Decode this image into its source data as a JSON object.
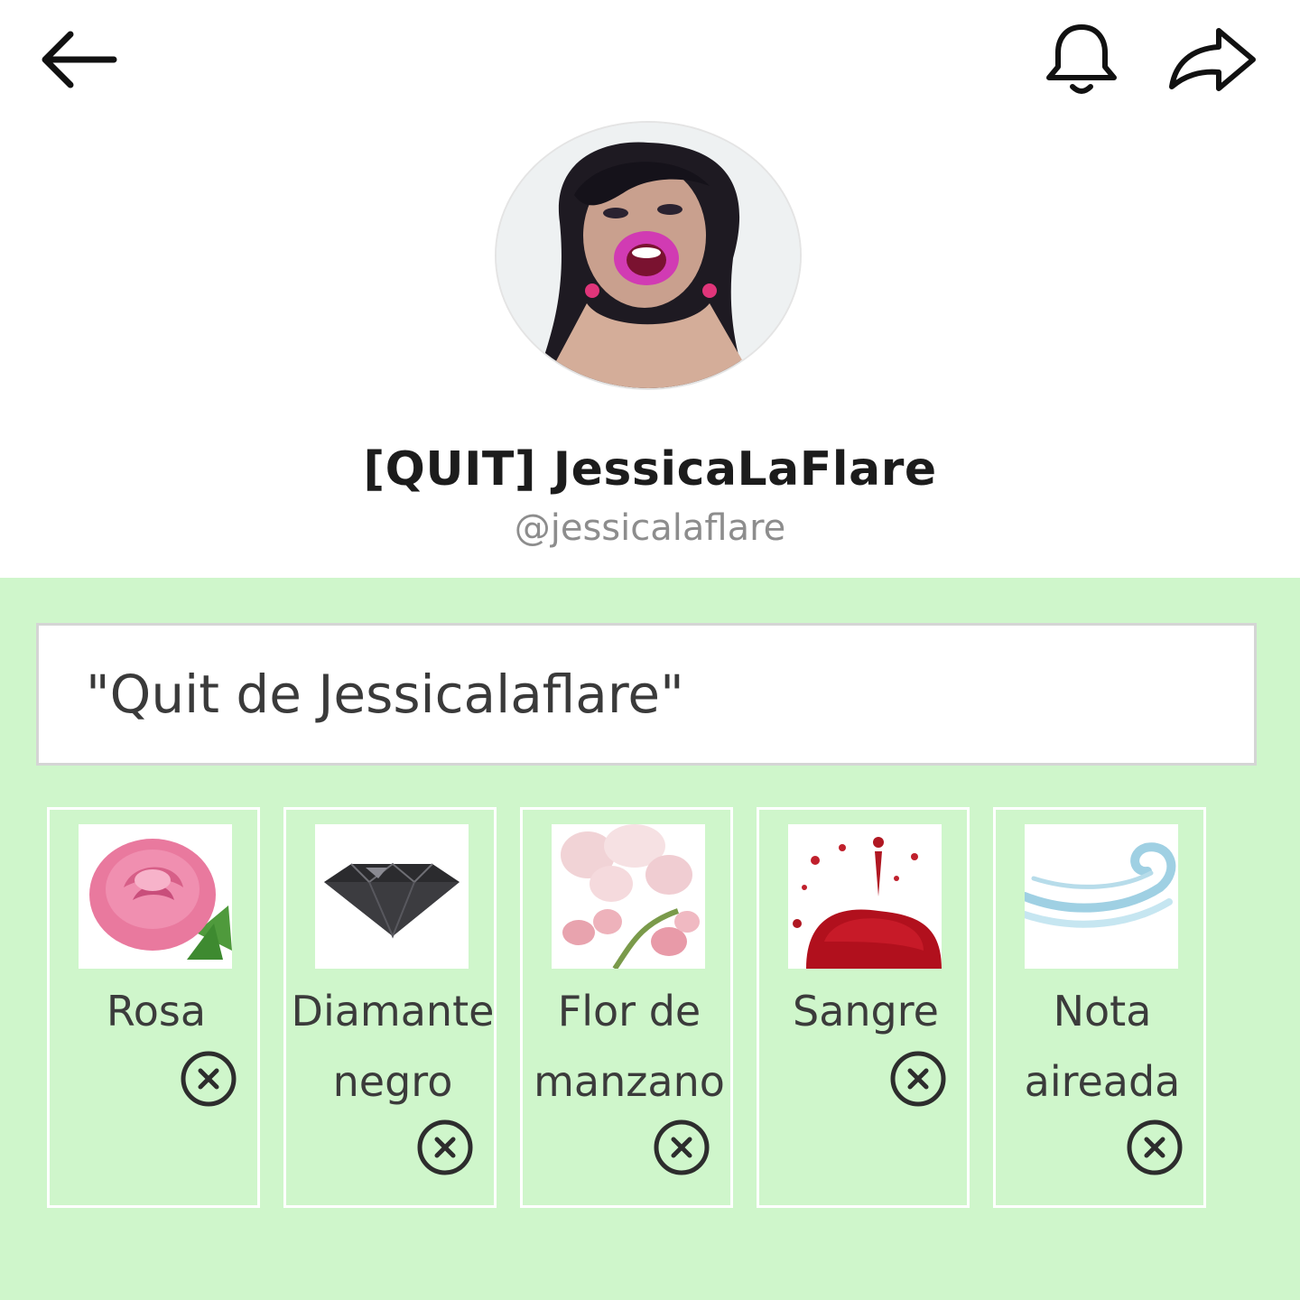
{
  "header": {
    "back_icon": "arrow-left-icon",
    "bell_icon": "bell-icon",
    "share_icon": "share-icon"
  },
  "profile": {
    "display_name": "[QUIT] JessicaLaFlare",
    "handle": "@jessicalaflare"
  },
  "panel": {
    "background": "#cff6cb",
    "title": "\"Quit de Jessicalaflare\"",
    "items": [
      {
        "label": "Rosa",
        "image": "pink-rose"
      },
      {
        "label": "Diamante negro",
        "image": "black-diamond"
      },
      {
        "label": "Flor de manzano",
        "image": "apple-blossom"
      },
      {
        "label": "Sangre",
        "image": "blood-splatter"
      },
      {
        "label": "Nota aireada",
        "image": "air-swirl"
      }
    ],
    "remove_icon": "close-circle-icon"
  }
}
